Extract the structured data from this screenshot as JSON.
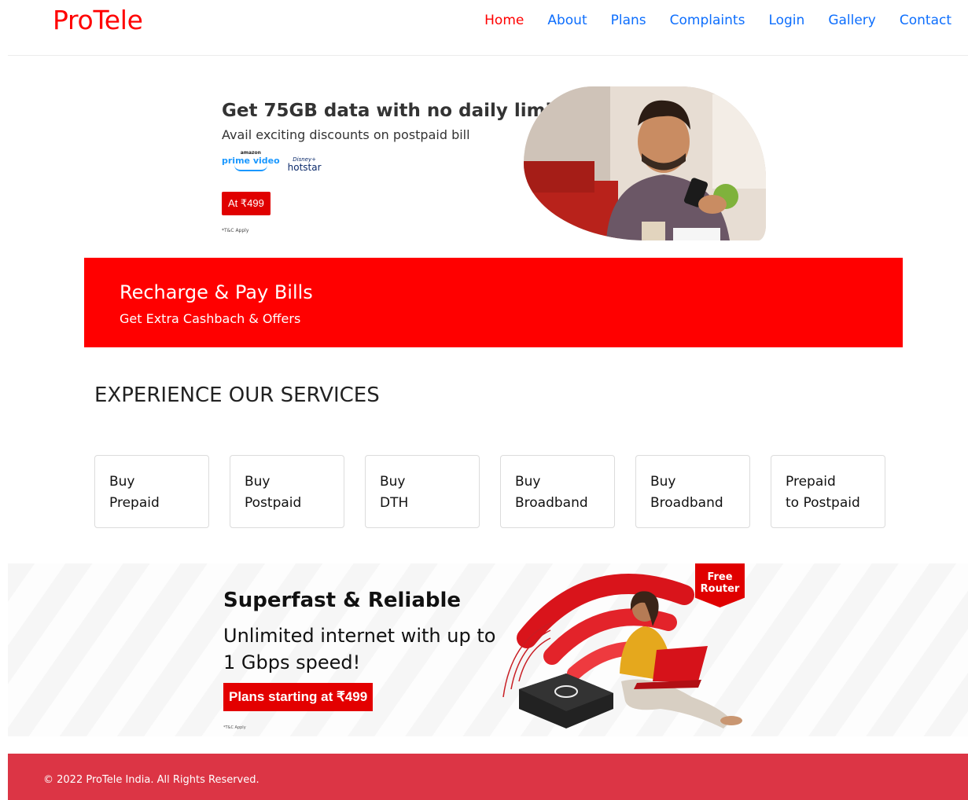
{
  "nav": {
    "brand": "ProTele",
    "links": [
      "Home",
      "About",
      "Plans",
      "Complaints",
      "Login",
      "Gallery",
      "Contact"
    ]
  },
  "hero1": {
    "title": "Get 75GB data with no daily limit",
    "subtitle": "Avail exciting discounts on postpaid bill",
    "partner1_small": "amazon",
    "partner1": "prime video",
    "partner2_small": "Disney+",
    "partner2": "hotstar",
    "price_button": "At ₹499",
    "tc": "*T&C Apply"
  },
  "banner": {
    "title": "Recharge & Pay Bills",
    "subtitle": "Get Extra Cashbach & Offers"
  },
  "services": {
    "title": "EXPERIENCE OUR SERVICES",
    "cards": [
      [
        "Buy",
        "Prepaid"
      ],
      [
        "Buy",
        "Postpaid"
      ],
      [
        "Buy",
        "DTH"
      ],
      [
        "Buy",
        "Broadband"
      ],
      [
        "Buy",
        "Broadband"
      ],
      [
        "Prepaid",
        "to Postpaid"
      ]
    ]
  },
  "hero2": {
    "title": "Superfast & Reliable",
    "subtitle": "Unlimited internet with up to 1 Gbps speed!",
    "button": "Plans starting at ₹499",
    "tc": "*T&C Apply",
    "badge_line1": "Free",
    "badge_line2": "Router"
  },
  "footer": {
    "text": "© 2022 ProTele India. All Rights Reserved."
  },
  "colors": {
    "brand_red": "#ff0000",
    "link_blue": "#0d6efd",
    "footer_red": "#dc3545"
  }
}
